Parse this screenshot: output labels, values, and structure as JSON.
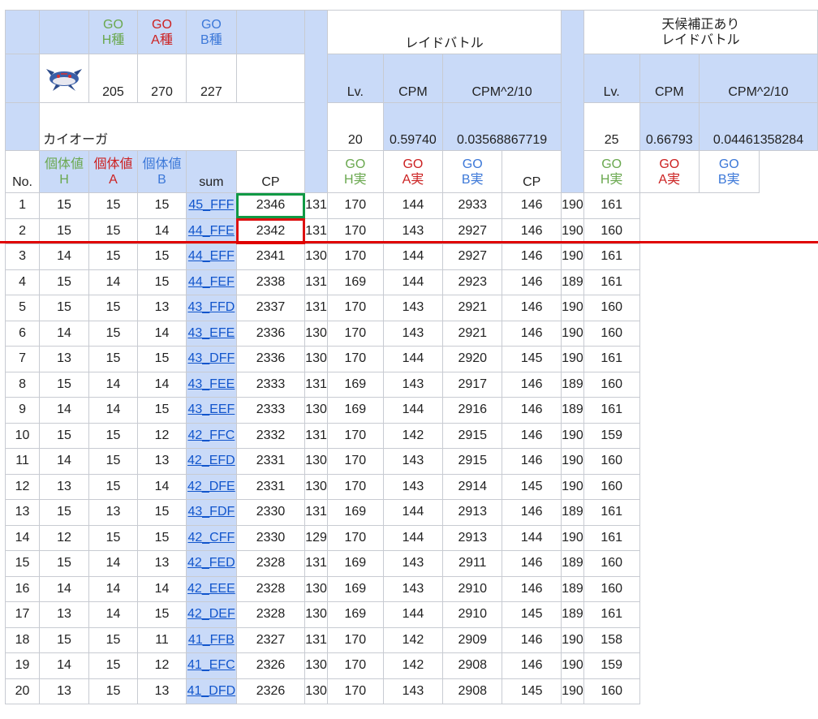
{
  "header": {
    "go_h_top": "GO",
    "go_h_bottom": "H種",
    "go_a_top": "GO",
    "go_a_bottom": "A種",
    "go_b_top": "GO",
    "go_b_bottom": "B種",
    "raid_title": "レイドバトル",
    "weather_title_line1": "天候補正あり",
    "weather_title_line2": "レイドバトル"
  },
  "species": {
    "name": "カイオーガ",
    "base_h": "205",
    "base_a": "270",
    "base_b": "227"
  },
  "raid": {
    "lv_label": "Lv.",
    "cpm_label": "CPM",
    "cpm2_label": "CPM^2/10",
    "lv": "20",
    "cpm": "0.59740",
    "cpm2": "0.03568867719"
  },
  "weather": {
    "lv_label": "Lv.",
    "cpm_label": "CPM",
    "cpm2_label": "CPM^2/10",
    "lv": "25",
    "cpm": "0.66793",
    "cpm2": "0.04461358284"
  },
  "columns": {
    "no": "No.",
    "iv_top": "個体値",
    "iv_h": "H",
    "iv_a": "A",
    "iv_b": "B",
    "sum": "sum",
    "cp": "CP",
    "real_top": "GO",
    "real_h": "H実",
    "real_a": "A実",
    "real_b": "B実"
  },
  "colors": {
    "header_blue": "#c9daf8",
    "h_green": "#6aa84f",
    "a_red": "#cc2222",
    "b_blue": "#3c78d8",
    "highlight_green": "#119944",
    "highlight_red": "#dd1111",
    "divider_red": "#e00000"
  },
  "rows": [
    {
      "no": "1",
      "h": "15",
      "a": "15",
      "b": "15",
      "sum": "45_FFF",
      "cp": "2346",
      "rh": "131",
      "ra": "170",
      "rb": "144",
      "wcp": "2933",
      "wh": "146",
      "wa": "190",
      "wb": "161"
    },
    {
      "no": "2",
      "h": "15",
      "a": "15",
      "b": "14",
      "sum": "44_FFE",
      "cp": "2342",
      "rh": "131",
      "ra": "170",
      "rb": "143",
      "wcp": "2927",
      "wh": "146",
      "wa": "190",
      "wb": "160"
    },
    {
      "no": "3",
      "h": "14",
      "a": "15",
      "b": "15",
      "sum": "44_EFF",
      "cp": "2341",
      "rh": "130",
      "ra": "170",
      "rb": "144",
      "wcp": "2927",
      "wh": "146",
      "wa": "190",
      "wb": "161"
    },
    {
      "no": "4",
      "h": "15",
      "a": "14",
      "b": "15",
      "sum": "44_FEF",
      "cp": "2338",
      "rh": "131",
      "ra": "169",
      "rb": "144",
      "wcp": "2923",
      "wh": "146",
      "wa": "189",
      "wb": "161"
    },
    {
      "no": "5",
      "h": "15",
      "a": "15",
      "b": "13",
      "sum": "43_FFD",
      "cp": "2337",
      "rh": "131",
      "ra": "170",
      "rb": "143",
      "wcp": "2921",
      "wh": "146",
      "wa": "190",
      "wb": "160"
    },
    {
      "no": "6",
      "h": "14",
      "a": "15",
      "b": "14",
      "sum": "43_EFE",
      "cp": "2336",
      "rh": "130",
      "ra": "170",
      "rb": "143",
      "wcp": "2921",
      "wh": "146",
      "wa": "190",
      "wb": "160"
    },
    {
      "no": "7",
      "h": "13",
      "a": "15",
      "b": "15",
      "sum": "43_DFF",
      "cp": "2336",
      "rh": "130",
      "ra": "170",
      "rb": "144",
      "wcp": "2920",
      "wh": "145",
      "wa": "190",
      "wb": "161"
    },
    {
      "no": "8",
      "h": "15",
      "a": "14",
      "b": "14",
      "sum": "43_FEE",
      "cp": "2333",
      "rh": "131",
      "ra": "169",
      "rb": "143",
      "wcp": "2917",
      "wh": "146",
      "wa": "189",
      "wb": "160"
    },
    {
      "no": "9",
      "h": "14",
      "a": "14",
      "b": "15",
      "sum": "43_EEF",
      "cp": "2333",
      "rh": "130",
      "ra": "169",
      "rb": "144",
      "wcp": "2916",
      "wh": "146",
      "wa": "189",
      "wb": "161"
    },
    {
      "no": "10",
      "h": "15",
      "a": "15",
      "b": "12",
      "sum": "42_FFC",
      "cp": "2332",
      "rh": "131",
      "ra": "170",
      "rb": "142",
      "wcp": "2915",
      "wh": "146",
      "wa": "190",
      "wb": "159"
    },
    {
      "no": "11",
      "h": "14",
      "a": "15",
      "b": "13",
      "sum": "42_EFD",
      "cp": "2331",
      "rh": "130",
      "ra": "170",
      "rb": "143",
      "wcp": "2915",
      "wh": "146",
      "wa": "190",
      "wb": "160"
    },
    {
      "no": "12",
      "h": "13",
      "a": "15",
      "b": "14",
      "sum": "42_DFE",
      "cp": "2331",
      "rh": "130",
      "ra": "170",
      "rb": "143",
      "wcp": "2914",
      "wh": "145",
      "wa": "190",
      "wb": "160"
    },
    {
      "no": "13",
      "h": "15",
      "a": "13",
      "b": "15",
      "sum": "43_FDF",
      "cp": "2330",
      "rh": "131",
      "ra": "169",
      "rb": "144",
      "wcp": "2913",
      "wh": "146",
      "wa": "189",
      "wb": "161"
    },
    {
      "no": "14",
      "h": "12",
      "a": "15",
      "b": "15",
      "sum": "42_CFF",
      "cp": "2330",
      "rh": "129",
      "ra": "170",
      "rb": "144",
      "wcp": "2913",
      "wh": "144",
      "wa": "190",
      "wb": "161"
    },
    {
      "no": "15",
      "h": "15",
      "a": "14",
      "b": "13",
      "sum": "42_FED",
      "cp": "2328",
      "rh": "131",
      "ra": "169",
      "rb": "143",
      "wcp": "2911",
      "wh": "146",
      "wa": "189",
      "wb": "160"
    },
    {
      "no": "16",
      "h": "14",
      "a": "14",
      "b": "14",
      "sum": "42_EEE",
      "cp": "2328",
      "rh": "130",
      "ra": "169",
      "rb": "143",
      "wcp": "2910",
      "wh": "146",
      "wa": "189",
      "wb": "160"
    },
    {
      "no": "17",
      "h": "13",
      "a": "14",
      "b": "15",
      "sum": "42_DEF",
      "cp": "2328",
      "rh": "130",
      "ra": "169",
      "rb": "144",
      "wcp": "2910",
      "wh": "145",
      "wa": "189",
      "wb": "161"
    },
    {
      "no": "18",
      "h": "15",
      "a": "15",
      "b": "11",
      "sum": "41_FFB",
      "cp": "2327",
      "rh": "131",
      "ra": "170",
      "rb": "142",
      "wcp": "2909",
      "wh": "146",
      "wa": "190",
      "wb": "158"
    },
    {
      "no": "19",
      "h": "14",
      "a": "15",
      "b": "12",
      "sum": "41_EFC",
      "cp": "2326",
      "rh": "130",
      "ra": "170",
      "rb": "142",
      "wcp": "2908",
      "wh": "146",
      "wa": "190",
      "wb": "159"
    },
    {
      "no": "20",
      "h": "13",
      "a": "15",
      "b": "13",
      "sum": "41_DFD",
      "cp": "2326",
      "rh": "130",
      "ra": "170",
      "rb": "143",
      "wcp": "2908",
      "wh": "145",
      "wa": "190",
      "wb": "160"
    }
  ]
}
